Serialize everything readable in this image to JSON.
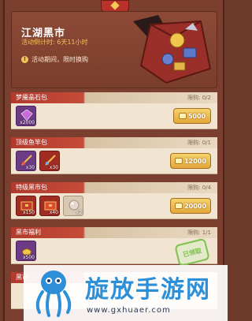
{
  "banner": {
    "title": "江湖黑市",
    "countdown": "活动倒计时: 6天11小时",
    "note": "活动期间，限时换购"
  },
  "sections": [
    {
      "name": "梦魇晶石包",
      "limit": "限购: 0/2",
      "items": [
        {
          "icon": "crystal-icon",
          "qty": "x2000",
          "color": "purple"
        }
      ],
      "price": "5000",
      "claimed": false
    },
    {
      "name": "顶级鱼竿包",
      "limit": "限购: 0/1",
      "items": [
        {
          "icon": "fishing-rod-icon",
          "qty": "x30",
          "color": "purple"
        },
        {
          "icon": "fishing-rod-icon",
          "qty": "x30",
          "color": "red"
        }
      ],
      "price": "12000",
      "claimed": false
    },
    {
      "name": "特级黑市包",
      "limit": "限购: 0/4",
      "items": [
        {
          "icon": "chest-icon",
          "qty": "x150",
          "color": "red"
        },
        {
          "icon": "chest-icon",
          "qty": "x40",
          "color": "red"
        },
        {
          "icon": "pearl-icon",
          "qty": "x2",
          "color": "cream"
        }
      ],
      "price": "20000",
      "claimed": false
    },
    {
      "name": "黑市福利",
      "limit": "限购: 1/1",
      "items": [
        {
          "icon": "ingot-icon",
          "qty": "x500",
          "color": "purple"
        }
      ],
      "claimed": true,
      "claimed_label": "已领取"
    },
    {
      "name": "黑市"
    }
  ],
  "watermark": {
    "title": "旋放手游网",
    "url": "www.gxhuaer.com"
  }
}
